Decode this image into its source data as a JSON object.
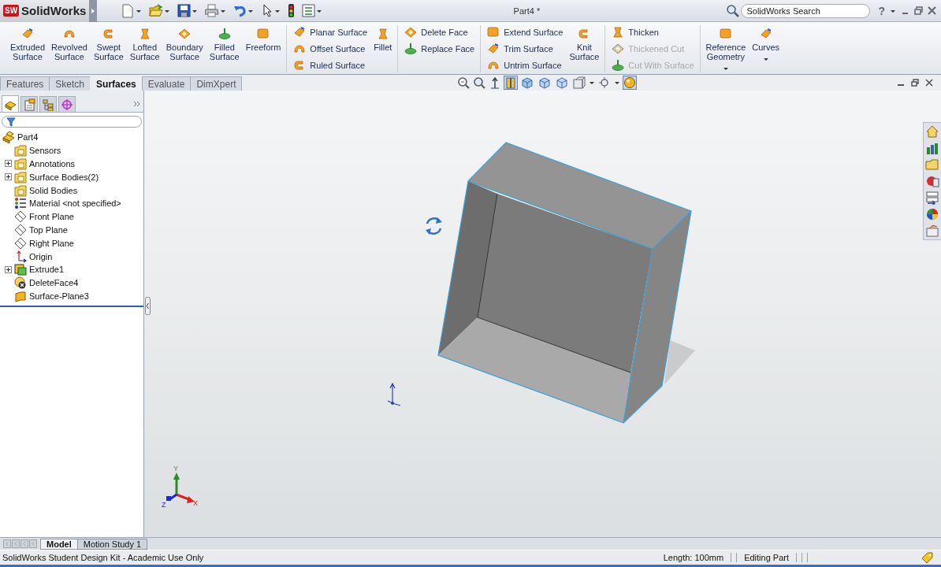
{
  "titlebar": {
    "logo_mark": "SW",
    "app_name": "SolidWorks",
    "title": "Part4 *",
    "search": {
      "placeholder": "SolidWorks Search"
    },
    "help": "?"
  },
  "ribbon": {
    "groups": [
      {
        "items": [
          {
            "kind": "large",
            "label": "Extruded Surface",
            "menu": false
          },
          {
            "kind": "large",
            "label": "Revolved Surface",
            "menu": false
          },
          {
            "kind": "large",
            "label": "Swept Surface",
            "menu": false
          },
          {
            "kind": "large",
            "label": "Lofted Surface",
            "menu": false
          },
          {
            "kind": "large",
            "label": "Boundary Surface",
            "menu": false
          },
          {
            "kind": "large",
            "label": "Filled Surface",
            "menu": false
          },
          {
            "kind": "large",
            "label": "Freeform",
            "menu": false
          }
        ]
      },
      {
        "items": [
          {
            "kind": "stack",
            "items": [
              {
                "label": "Planar Surface",
                "disabled": false
              },
              {
                "label": "Offset Surface",
                "disabled": false
              },
              {
                "label": "Ruled Surface",
                "disabled": false
              }
            ]
          },
          {
            "kind": "large",
            "label": "Fillet",
            "menu": false
          }
        ]
      },
      {
        "items": [
          {
            "kind": "stack",
            "items": [
              {
                "label": "Delete Face",
                "disabled": false
              },
              {
                "label": "Replace Face",
                "disabled": false
              }
            ]
          }
        ]
      },
      {
        "items": [
          {
            "kind": "stack",
            "items": [
              {
                "label": "Extend Surface",
                "disabled": false
              },
              {
                "label": "Trim Surface",
                "disabled": false
              },
              {
                "label": "Untrim Surface",
                "disabled": false
              }
            ]
          },
          {
            "kind": "large",
            "label": "Knit Surface",
            "menu": false
          }
        ]
      },
      {
        "items": [
          {
            "kind": "stack",
            "items": [
              {
                "label": "Thicken",
                "disabled": false
              },
              {
                "label": "Thickened Cut",
                "disabled": true
              },
              {
                "label": "Cut With Surface",
                "disabled": true
              }
            ]
          }
        ]
      },
      {
        "items": [
          {
            "kind": "large",
            "label": "Reference Geometry",
            "menu": true
          },
          {
            "kind": "large",
            "label": "Curves",
            "menu": true
          }
        ]
      }
    ]
  },
  "command_tabs": [
    {
      "label": "Features",
      "selected": false
    },
    {
      "label": "Sketch",
      "selected": false
    },
    {
      "label": "Surfaces",
      "selected": true
    },
    {
      "label": "Evaluate",
      "selected": false
    },
    {
      "label": "DimXpert",
      "selected": false
    }
  ],
  "feature_manager": {
    "tabs": [
      {
        "selected": true
      },
      {
        "selected": false
      },
      {
        "selected": false
      },
      {
        "selected": false
      }
    ],
    "tree": {
      "label": "Part4",
      "kind": "part",
      "children": [
        {
          "label": "Sensors",
          "kind": "folder",
          "collapsed": false
        },
        {
          "label": "Annotations",
          "kind": "folder",
          "collapsed": true
        },
        {
          "label": "Surface Bodies(2)",
          "kind": "folder",
          "collapsed": true
        },
        {
          "label": "Solid Bodies",
          "kind": "folder",
          "collapsed": false
        },
        {
          "label": "Material <not specified>",
          "kind": "material",
          "collapsed": false
        },
        {
          "label": "Front Plane",
          "kind": "plane",
          "collapsed": false
        },
        {
          "label": "Top Plane",
          "kind": "plane",
          "collapsed": false
        },
        {
          "label": "Right Plane",
          "kind": "plane",
          "collapsed": false
        },
        {
          "label": "Origin",
          "kind": "origin",
          "collapsed": false
        },
        {
          "label": "Extrude1",
          "kind": "feature",
          "collapsed": true
        },
        {
          "label": "DeleteFace4",
          "kind": "delete",
          "collapsed": false
        },
        {
          "label": "Surface-Plane3",
          "kind": "surface",
          "collapsed": false
        }
      ]
    }
  },
  "viewport": {
    "triad": {
      "x_label": "X",
      "y_label": "Y",
      "z_label": "Z"
    }
  },
  "bottom_tabs": [
    {
      "label": "Model",
      "selected": true
    },
    {
      "label": "Motion Study 1",
      "selected": false
    }
  ],
  "status_bar": {
    "message": "SolidWorks Student Design Kit - Academic Use Only",
    "length": "Length: 100mm",
    "mode": "Editing Part"
  }
}
